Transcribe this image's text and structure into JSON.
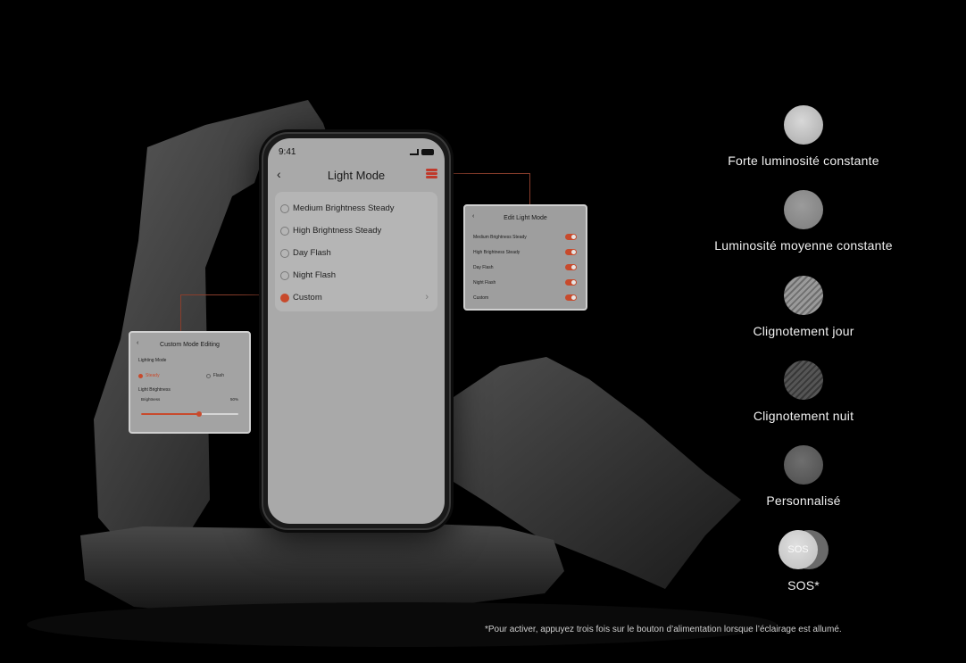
{
  "phone": {
    "time": "9:41",
    "title": "Light Mode",
    "modes": [
      {
        "label": "Medium Brightness Steady",
        "selected": false
      },
      {
        "label": "High Brightness Steady",
        "selected": false
      },
      {
        "label": "Day Flash",
        "selected": false
      },
      {
        "label": "Night Flash",
        "selected": false
      },
      {
        "label": "Custom",
        "selected": true
      }
    ]
  },
  "edit_card": {
    "title": "Edit Light Mode",
    "rows": [
      "Medium Brightness Steady",
      "High Brightness Steady",
      "Day Flash",
      "Night Flash",
      "Custom"
    ]
  },
  "custom_card": {
    "title": "Custom Mode Editing",
    "lighting_mode_label": "Lighting Mode",
    "steady_label": "Steady",
    "flash_label": "Flash",
    "light_brightness_label": "Light Brightness",
    "brightness_label": "Brightness",
    "brightness_value": "50%",
    "brightness_fraction": 0.6
  },
  "legend": {
    "items": [
      "Forte luminosité constante",
      "Luminosité moyenne constante",
      "Clignotement jour",
      "Clignotement nuit",
      "Personnalisé",
      "SOS*"
    ],
    "sos_badge": "SOS"
  },
  "footnote": "*Pour activer, appuyez trois fois sur le bouton d’alimentation lorsque l’éclairage est allumé.",
  "colors": {
    "accent": "#c84a2c",
    "background": "#000000"
  }
}
